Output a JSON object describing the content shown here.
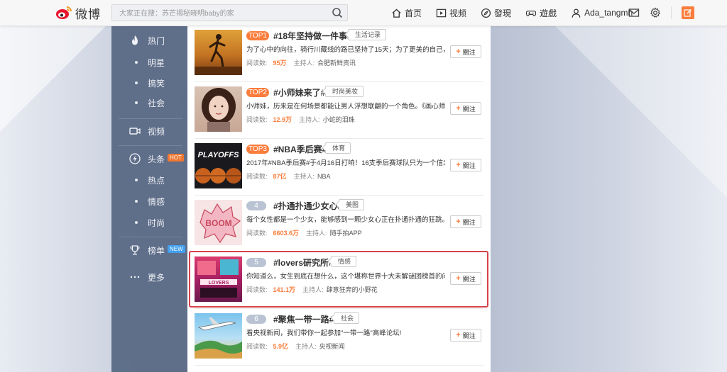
{
  "header": {
    "logo_text": "微博",
    "search_placeholder": "大家正在搜：苏芒揭秘晓明baby的家",
    "nav": [
      {
        "label": "首页",
        "icon": "home-icon"
      },
      {
        "label": "视频",
        "icon": "video-icon"
      },
      {
        "label": "發現",
        "icon": "compass-icon"
      },
      {
        "label": "遊戲",
        "icon": "gamepad-icon"
      },
      {
        "label": "Ada_tangmh",
        "icon": "user-icon"
      }
    ],
    "tools": [
      "mail-icon",
      "gear-icon",
      "compose-icon"
    ]
  },
  "sidebar": {
    "items": [
      {
        "label": "热门",
        "icon": "flame-icon"
      },
      {
        "label": "明星"
      },
      {
        "label": "搞笑"
      },
      {
        "label": "社会"
      },
      {
        "label": "视频",
        "icon": "video-camera-icon"
      },
      {
        "label": "头条",
        "icon": "bolt-icon",
        "badge": "HOT"
      },
      {
        "label": "热点"
      },
      {
        "label": "情感"
      },
      {
        "label": "时尚"
      },
      {
        "label": "榜单",
        "icon": "trophy-icon",
        "badge": "NEW"
      },
      {
        "label": "更多",
        "icon": "more-icon"
      }
    ]
  },
  "list": {
    "read_label": "阅读数:",
    "host_label": "主持人:",
    "follow_label": "關注",
    "items": [
      {
        "rank": "TOP1",
        "title": "#18年坚持做一件事#",
        "tag": "生活记录",
        "desc": "为了心中的向往，骑行川藏线的路已坚持了15天；为了更美的自己，健身...",
        "reads": "95万",
        "host": "合肥新鲜资讯"
      },
      {
        "rank": "TOP2",
        "title": "#小师妹来了#",
        "tag": "时尚美妆",
        "desc": "小师妹，历来是在何场景都能让男人浮想联翩的一个角色。《画心师》...",
        "reads": "12.9万",
        "host": "小蛇的泪珠"
      },
      {
        "rank": "TOP3",
        "title": "#NBA季后赛#",
        "tag": "体育",
        "desc": "2017年#NBA季后赛#于4月16日打响！16支季后赛球队只为一个信念。那就...",
        "reads": "87亿",
        "host": "NBA"
      },
      {
        "rank": "4",
        "title": "#扑通扑通少女心#",
        "tag": "美图",
        "desc": "每个女性都是一个少女，能够感到一颗少女心正在扑通扑通的狂跳。来，...",
        "reads": "6603.6万",
        "host": "随手拍APP"
      },
      {
        "rank": "5",
        "title": "#lovers研究所#",
        "tag": "情感",
        "desc": "你知道么，女生到底在想什么，这个堪称世界十大未解谜团榜首的问题，...",
        "reads": "141.1万",
        "host": "肆意狂奔的小野花"
      },
      {
        "rank": "6",
        "title": "#聚焦一带一路#",
        "tag": "社会",
        "desc": "看央视新闻，我们带你一起参加\"一带一路\"高峰论坛!",
        "reads": "5.9亿",
        "host": "央视新闻"
      }
    ]
  },
  "thumb_texts": {
    "playoffs": "PLAYOFFS",
    "boom": "BOOM",
    "lovers": "LOVERS"
  },
  "colors": {
    "accent": "#fa7d3c",
    "sidebar": "#5b6b86",
    "highlight": "#d6434a",
    "rank_gray": "#b9c3d3"
  }
}
